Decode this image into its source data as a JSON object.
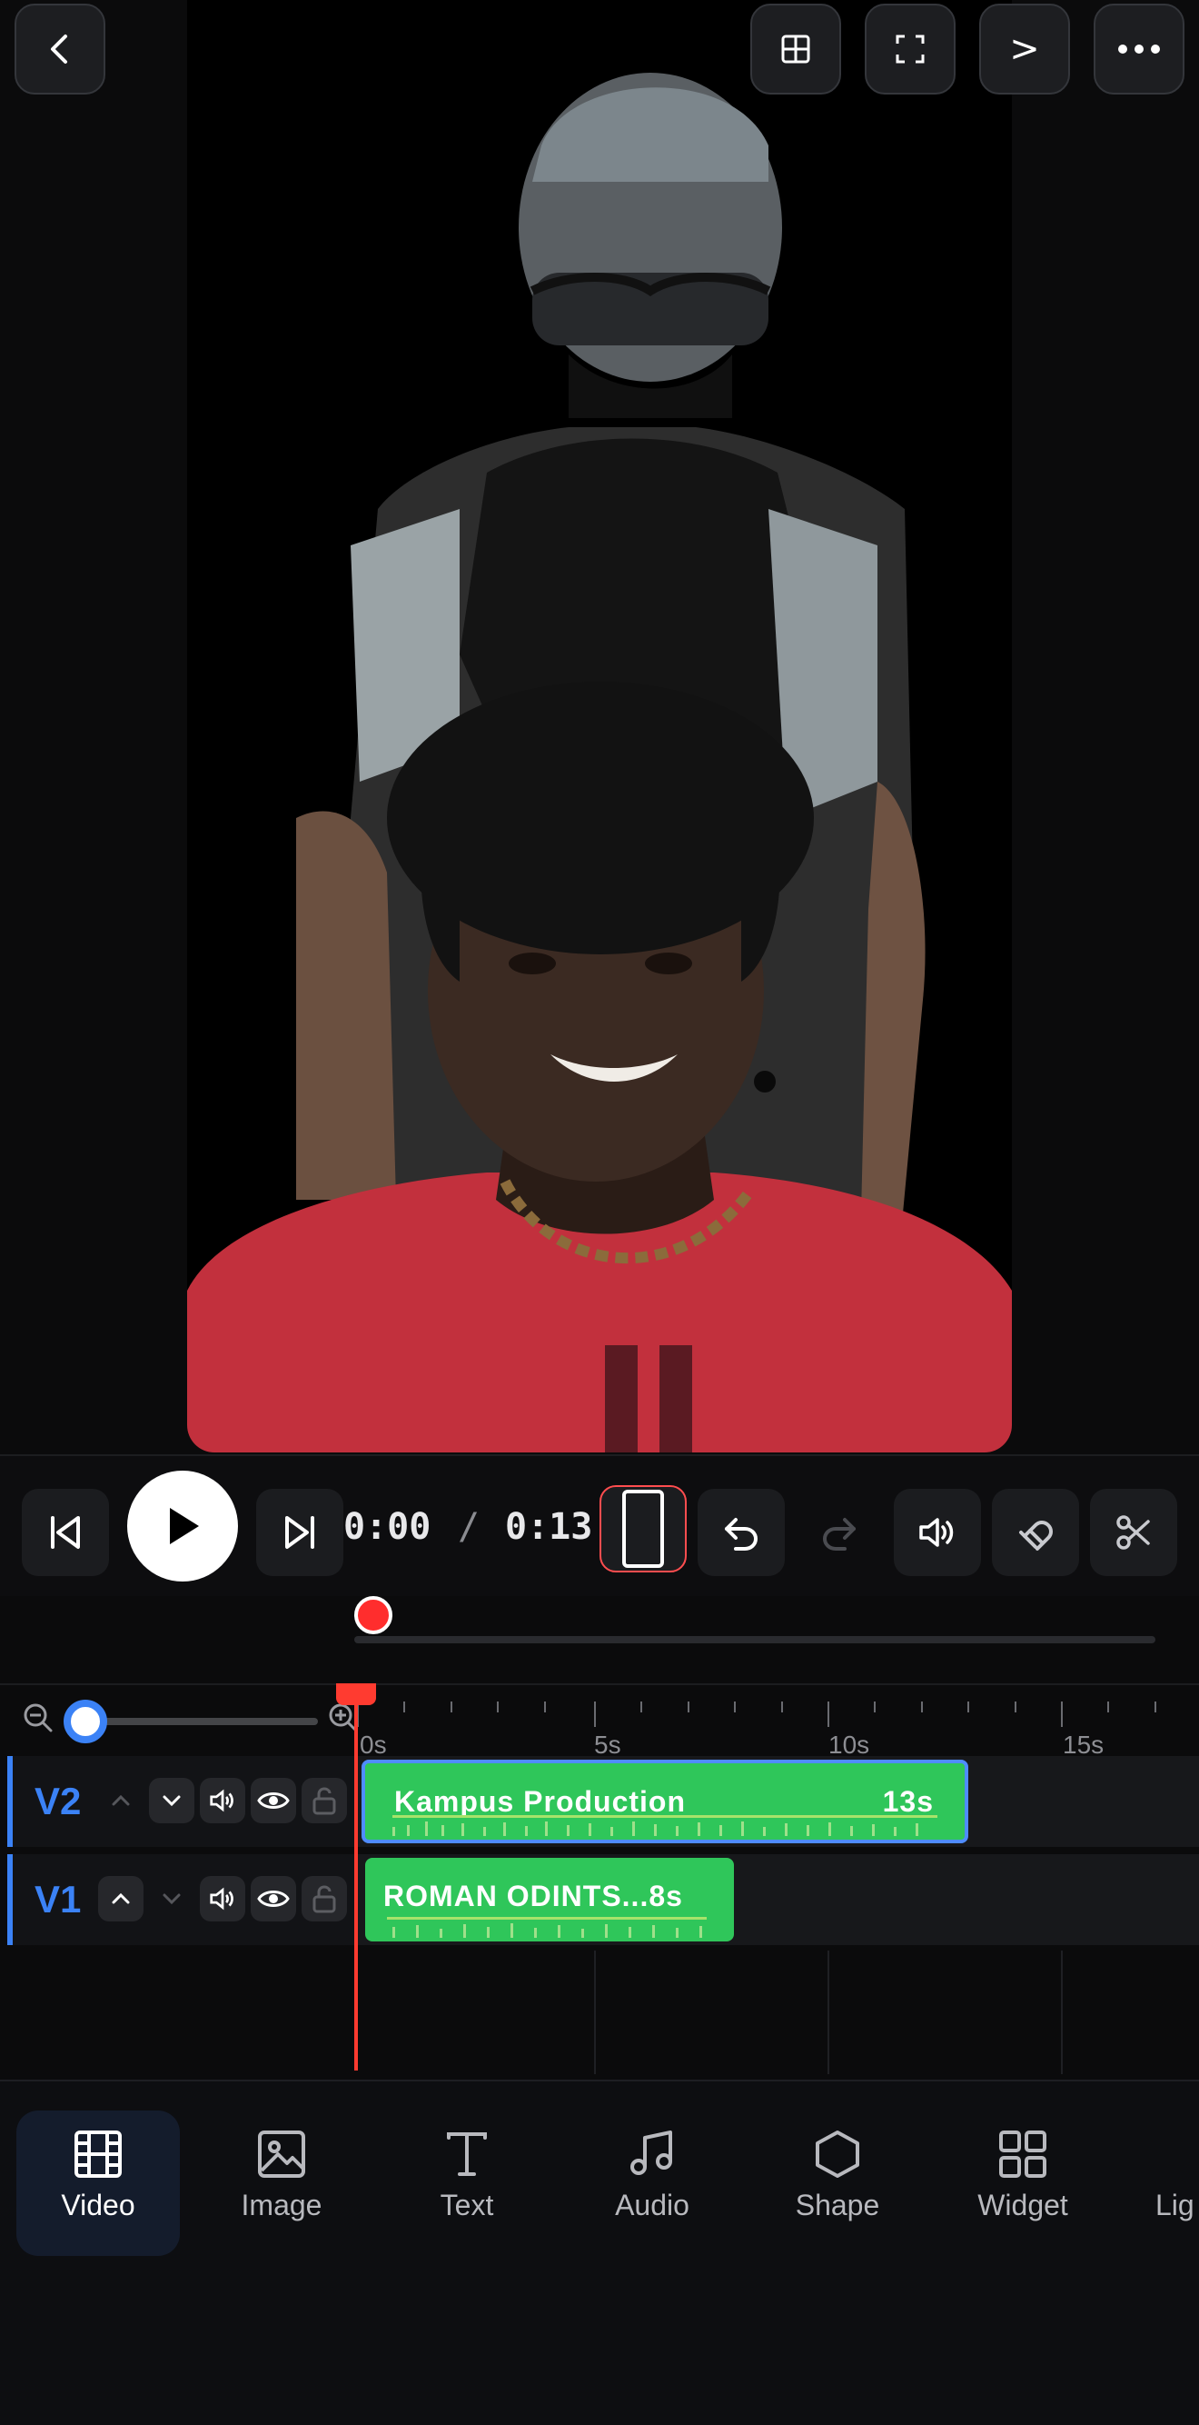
{
  "top_bar": {
    "back_icon": "chevron-left-icon",
    "grid_icon": "grid-icon",
    "fullscreen_icon": "fullscreen-icon",
    "next_label": ">",
    "more_icon": "more-horizontal-icon"
  },
  "playback": {
    "current_time": "0:00",
    "separator": "/",
    "total_time": "0:13"
  },
  "timeline": {
    "ruler_labels": [
      "0s",
      "5s",
      "10s",
      "15s"
    ],
    "tracks": [
      {
        "label": "V2",
        "clip_name": "Kampus Production",
        "clip_duration": "13s"
      },
      {
        "label": "V1",
        "clip_name": "ROMAN ODINTS...8s",
        "clip_duration": ""
      }
    ]
  },
  "bottom_nav": {
    "items": [
      {
        "label": "Video",
        "icon": "film-icon"
      },
      {
        "label": "Image",
        "icon": "image-icon"
      },
      {
        "label": "Text",
        "icon": "text-icon"
      },
      {
        "label": "Audio",
        "icon": "music-note-icon"
      },
      {
        "label": "Shape",
        "icon": "hexagon-icon"
      },
      {
        "label": "Widget",
        "icon": "widget-grid-icon"
      },
      {
        "label": "Lig",
        "icon": ""
      }
    ]
  },
  "colors": {
    "accent": "#3b82f6",
    "clip_green": "#2fc65a",
    "playhead": "#ff3b30"
  }
}
